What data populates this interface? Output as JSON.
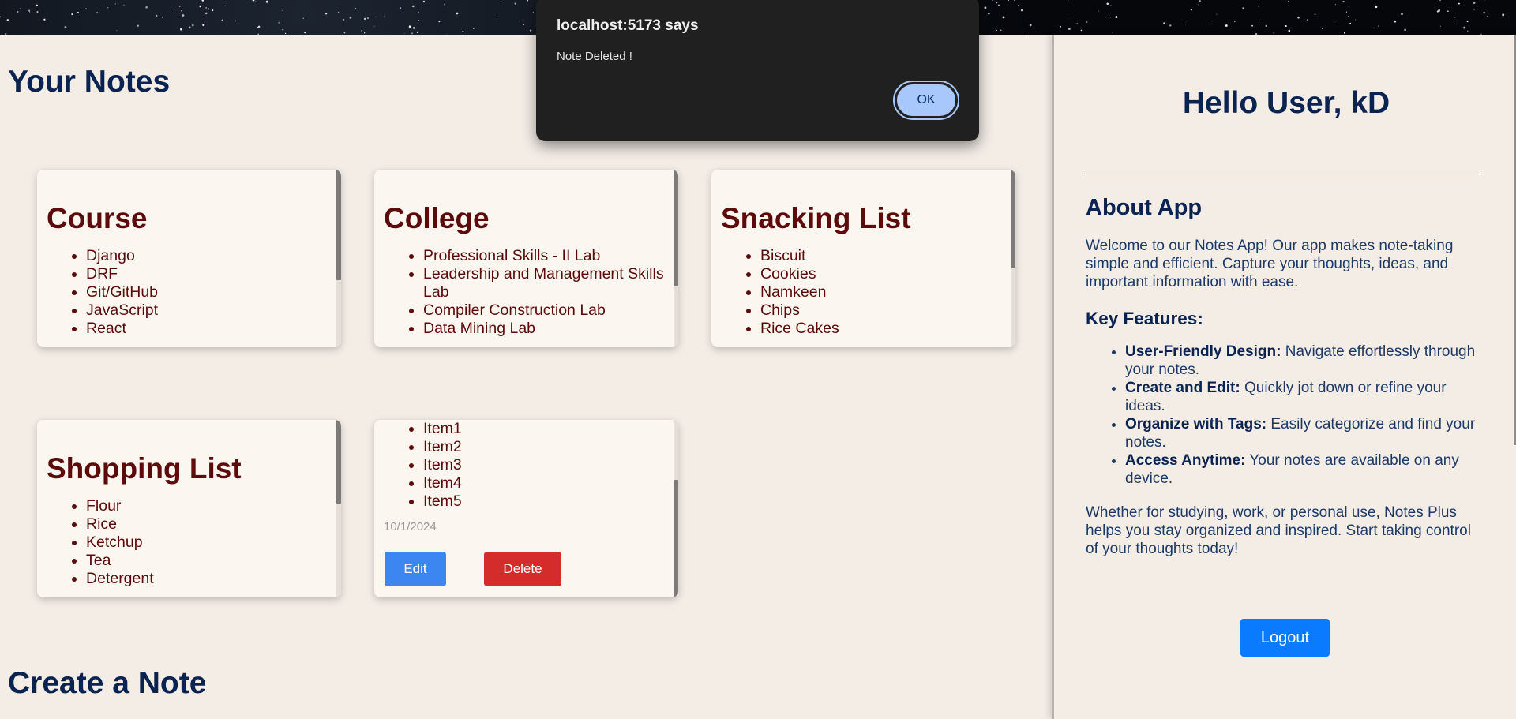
{
  "dialog": {
    "title": "localhost:5173 says",
    "message": "Note Deleted !",
    "ok_label": "OK"
  },
  "main": {
    "notes_heading": "Your Notes",
    "create_heading": "Create a Note",
    "notes": [
      {
        "title": "Course",
        "items": [
          "Django",
          "DRF",
          "Git/GitHub",
          "JavaScript",
          "React"
        ]
      },
      {
        "title": "College",
        "items": [
          "Professional Skills - II Lab",
          "Leadership and Management Skills Lab",
          "Compiler Construction Lab",
          "Data Mining Lab"
        ]
      },
      {
        "title": "Snacking List",
        "items": [
          "Biscuit",
          "Cookies",
          "Namkeen",
          "Chips",
          "Rice Cakes"
        ]
      },
      {
        "title": "Shopping List",
        "items": [
          "Flour",
          "Rice",
          "Ketchup",
          "Tea",
          "Detergent"
        ]
      },
      {
        "title": "",
        "items": [
          "Item1",
          "Item2",
          "Item3",
          "Item4",
          "Item5"
        ],
        "date": "10/1/2024",
        "edit_label": "Edit",
        "delete_label": "Delete"
      }
    ]
  },
  "panel": {
    "greeting": "Hello User, kD",
    "about_title": "About App",
    "about_text": "Welcome to our Notes App! Our app makes note-taking simple and efficient. Capture your thoughts, ideas, and important information with ease.",
    "features_title": "Key Features:",
    "features": [
      {
        "name": "User-Friendly Design:",
        "desc": " Navigate effortlessly through your notes."
      },
      {
        "name": "Create and Edit:",
        "desc": " Quickly jot down or refine your ideas."
      },
      {
        "name": "Organize with Tags:",
        "desc": " Easily categorize and find your notes."
      },
      {
        "name": "Access Anytime:",
        "desc": " Your notes are available on any device."
      }
    ],
    "closing_text": "Whether for studying, work, or personal use, Notes Plus helps you stay organized and inspired. Start taking control of your thoughts today!",
    "logout_label": "Logout"
  },
  "colors": {
    "background": "#f3ede6",
    "heading": "#0b2350",
    "note_text": "#5c0a0a",
    "edit_button": "#3b86f0",
    "delete_button": "#d42b2b",
    "logout_button": "#0a7bff",
    "dialog_bg": "#202020",
    "dialog_ok": "#a8c7fa"
  }
}
